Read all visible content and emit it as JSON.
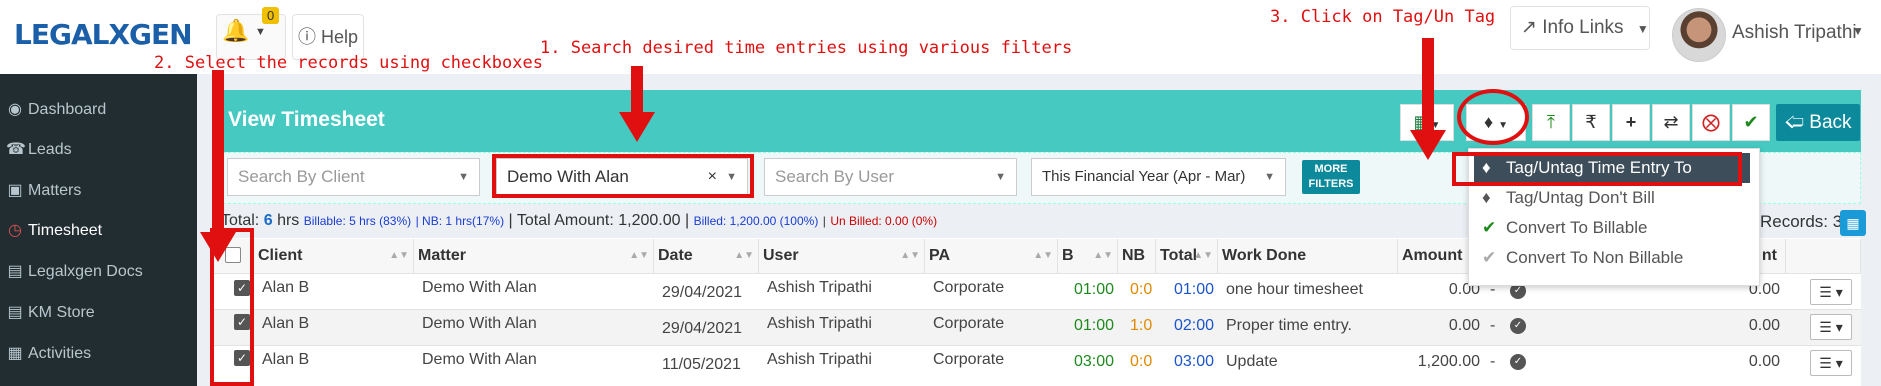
{
  "app": {
    "logo": "LEGALXGEN"
  },
  "topbar": {
    "notification_count": "0",
    "help_label": "Help",
    "info_links_label": "Info Links",
    "user_name": "Ashish Tripathi"
  },
  "sidebar": {
    "items": [
      {
        "label": "Dashboard",
        "icon": "dashboard-icon"
      },
      {
        "label": "Leads",
        "icon": "phone-icon"
      },
      {
        "label": "Matters",
        "icon": "briefcase-icon"
      },
      {
        "label": "Timesheet",
        "icon": "clock-icon"
      },
      {
        "label": "Legalxgen Docs",
        "icon": "folder-icon"
      },
      {
        "label": "KM Store",
        "icon": "folder-icon"
      },
      {
        "label": "Activities",
        "icon": "calendar-icon"
      }
    ]
  },
  "page": {
    "title": "View Timesheet",
    "back_label": "Back"
  },
  "filters": {
    "client_placeholder": "Search By Client",
    "matter_value": "Demo With Alan",
    "user_placeholder": "Search By User",
    "period_value": "This Financial Year (Apr - Mar)",
    "more_filters_label": "MORE FILTERS"
  },
  "totals": {
    "total_label": "Total:",
    "total_hrs": "6",
    "hrs_unit": "hrs",
    "billable": "Billable: 5 hrs (83%)",
    "nb": "| NB: 1 hrs(17%)",
    "total_amount": "| Total Amount: 1,200.00 |",
    "billed": "Billed: 1,200.00 (100%)",
    "unbilled": "Un Billed: 0.00 (0%)",
    "records": "Records: 3"
  },
  "table": {
    "columns": [
      "Client",
      "Matter",
      "Date",
      "User",
      "PA",
      "B",
      "NB",
      "Total",
      "Work Done",
      "Amount",
      "nt"
    ],
    "rows": [
      {
        "client": "Alan B",
        "matter": "Demo With Alan",
        "date": "29/04/2021",
        "user": "Ashish Tripathi",
        "pa": "Corporate",
        "b": "01:00",
        "nb": "0:0",
        "total": "01:00",
        "work": "one hour timesheet",
        "amount": "0.00",
        "dash": "-",
        "amount2": "0.00"
      },
      {
        "client": "Alan B",
        "matter": "Demo With Alan",
        "date": "29/04/2021",
        "user": "Ashish Tripathi",
        "pa": "Corporate",
        "b": "01:00",
        "nb": "1:0",
        "total": "02:00",
        "work": "Proper time entry.",
        "amount": "0.00",
        "dash": "-",
        "amount2": "0.00"
      },
      {
        "client": "Alan B",
        "matter": "Demo With Alan",
        "date": "11/05/2021",
        "user": "Ashish Tripathi",
        "pa": "Corporate",
        "b": "03:00",
        "nb": "0:0",
        "total": "03:00",
        "work": "Update",
        "amount": "1,200.00",
        "dash": "-",
        "amount2": "0.00"
      }
    ]
  },
  "tag_menu": {
    "items": [
      "Tag/Untag Time Entry To Invoice",
      "Tag/Untag Don't Bill",
      "Convert To Billable",
      "Convert To Non Billable"
    ]
  },
  "annotations": {
    "step1": "1. Search desired time entries using various filters",
    "step2": "2. Select the records using checkboxes",
    "step3": "3. Click on Tag/Un Tag"
  },
  "colors": {
    "header": "#45c9c1",
    "sidebar": "#222d32",
    "annotation": "#e01010",
    "back_button": "#0c8a9b"
  }
}
